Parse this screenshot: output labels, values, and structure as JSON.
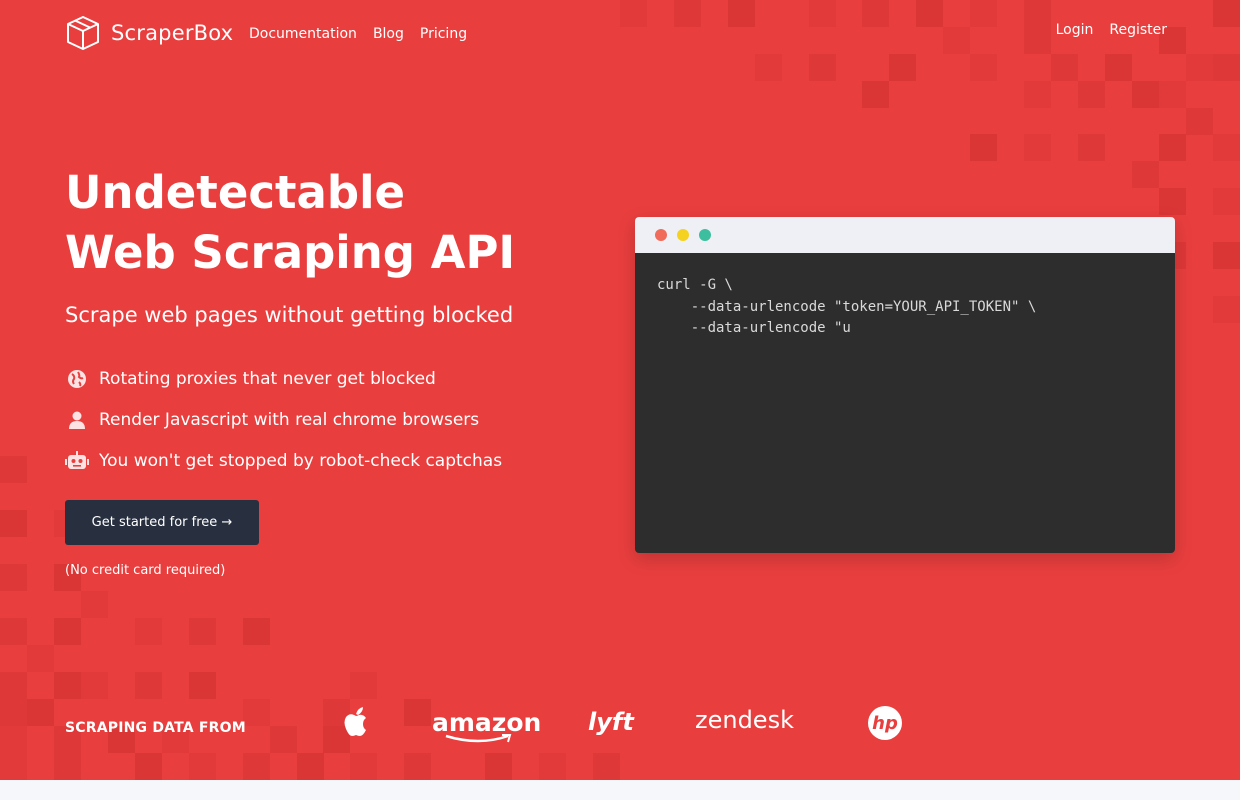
{
  "brand": {
    "name": "ScraperBox",
    "icon": "box-icon"
  },
  "nav": {
    "links": [
      "Documentation",
      "Blog",
      "Pricing"
    ],
    "right": [
      "Login",
      "Register"
    ]
  },
  "hero": {
    "headline_line1": "Undetectable",
    "headline_line2": "Web Scraping API",
    "subhead": "Scrape web pages without getting blocked",
    "features": [
      {
        "icon": "globe-icon",
        "text": "Rotating proxies that never get blocked"
      },
      {
        "icon": "user-icon",
        "text": "Render Javascript with real chrome browsers"
      },
      {
        "icon": "robot-icon",
        "text": "You won't get stopped by robot-check captchas"
      }
    ],
    "cta_label": "Get started for free →",
    "cta_note": "(No credit card required)"
  },
  "terminal": {
    "dots": [
      "#f06b5a",
      "#f4d21f",
      "#3dbf9f"
    ],
    "code": "curl -G \\\n    --data-urlencode \"token=YOUR_API_TOKEN\" \\\n    --data-urlencode \"u"
  },
  "logos": {
    "label": "SCRAPING DATA FROM",
    "items": [
      {
        "icon": "apple-icon",
        "text": ""
      },
      {
        "icon": "amazon-logo",
        "text": "amazon"
      },
      {
        "icon": "lyft-logo",
        "text": "lyft"
      },
      {
        "icon": "zendesk-logo",
        "text": "zendesk"
      },
      {
        "icon": "hp-logo",
        "text": "hp"
      }
    ]
  },
  "colors": {
    "background": "#e93e3e",
    "cta": "#283040",
    "terminal_body": "#2d2d2d",
    "terminal_bar": "#eef0f5"
  }
}
